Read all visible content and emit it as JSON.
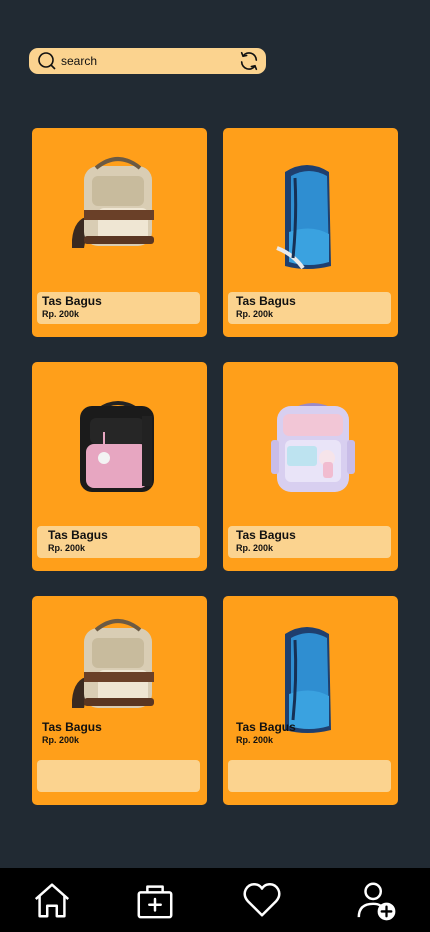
{
  "search": {
    "placeholder": "search",
    "icon": "search-icon",
    "refresh_icon": "refresh-icon"
  },
  "products": [
    {
      "name": "Tas Bagus",
      "price": "Rp. 200k",
      "bag": "beige"
    },
    {
      "name": "Tas Bagus",
      "price": "Rp. 200k",
      "bag": "blue"
    },
    {
      "name": "Tas Bagus",
      "price": "Rp. 200k",
      "bag": "pink-black"
    },
    {
      "name": "Tas Bagus",
      "price": "Rp. 200k",
      "bag": "lilac"
    },
    {
      "name": "Tas Bagus",
      "price": "Rp. 200k",
      "bag": "beige"
    },
    {
      "name": "Tas Bagus",
      "price": "Rp. 200k",
      "bag": "blue"
    }
  ],
  "nav": {
    "items": [
      "home-icon",
      "medical-bag-icon",
      "heart-icon",
      "add-user-icon"
    ]
  },
  "colors": {
    "background": "#212a33",
    "card": "#ff9f1a",
    "info_panel": "#fbd38f",
    "navbar": "#000000"
  }
}
